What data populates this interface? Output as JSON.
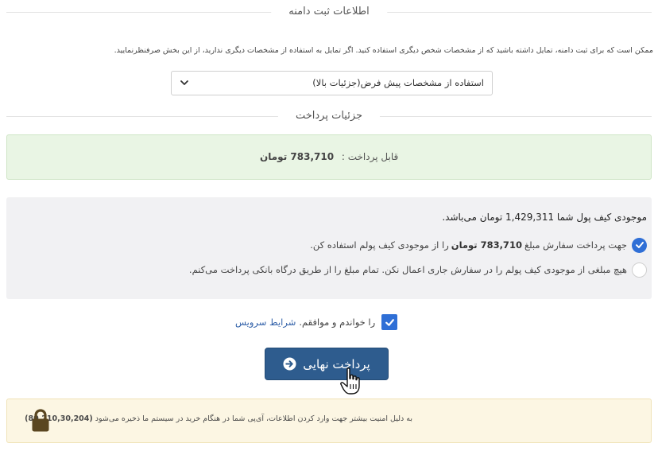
{
  "domain_registration": {
    "title": "اطلاعات ثبت دامنه",
    "notice": "ممکن است که برای ثبت دامنه، تمایل داشته باشید که از مشخصات شخص دیگری استفاده کنید. اگر تمایل به استفاده از مشخصات دیگری ندارید، از این بخش صرفنظرنمایید.",
    "contact_select_value": "استفاده از مشخصات پیش فرض(جزئیات بالا)"
  },
  "payment": {
    "title": "جزئیات پرداخت",
    "payable_label": "قابل پرداخت :",
    "payable_amount": "783,710 تومان"
  },
  "wallet": {
    "balance_text": "موجودی کیف پول شما 1,429,311 تومان می‌باشد.",
    "option1_pre": "جهت پرداخت سفارش مبلغ",
    "option1_amount": "783,710 تومان",
    "option1_post": "را از موجودی کیف پولم استفاده کن.",
    "option1_checked": true,
    "option2": "هیچ مبلغی از موجودی کیف پولم را در سفارش جاری اعمال نکن. تمام مبلغ را از طریق درگاه بانکی پرداخت می‌کنم.",
    "option2_checked": false
  },
  "terms": {
    "text": "را خواندم و موافقم.",
    "link": "شرایط سرویس",
    "checked": true
  },
  "final_pay_button": "پرداخت نهایی",
  "security": {
    "text": "به دلیل امنیت بیشتر جهت وارد کردن اطلاعات، آی‌پی شما در هنگام خرید در سیستم ما ذخیره می‌شود",
    "ip": "(80,210,30,204)"
  },
  "colors": {
    "accent": "#2f6fd6",
    "button": "#2e5c8e",
    "success_bg": "#e9f5e4",
    "warning_bg": "#fcf6e3",
    "lock": "#5a4620"
  },
  "icons": [
    "chevron-down-icon",
    "check-icon",
    "arrow-circle-right-icon",
    "hand-cursor-icon",
    "lock-icon"
  ]
}
